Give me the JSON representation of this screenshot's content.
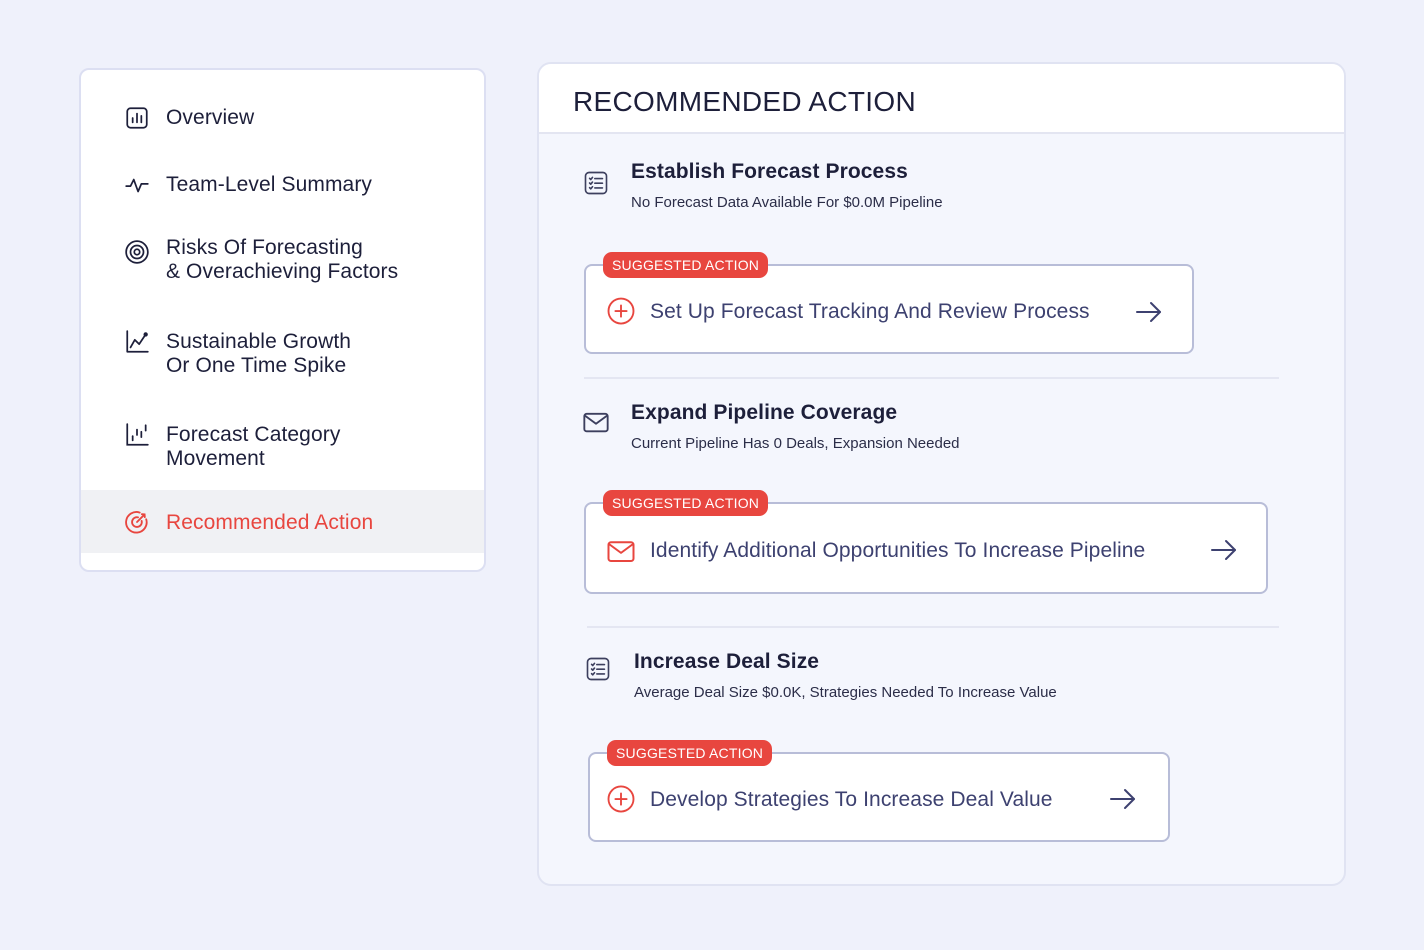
{
  "sidebar": {
    "items": [
      {
        "label": "Overview",
        "icon": "bar-chart-icon",
        "active": false
      },
      {
        "label": "Team-Level Summary",
        "icon": "pulse-icon",
        "active": false
      },
      {
        "label": "Risks Of Forecasting\n& Overachieving Factors",
        "icon": "target-icon",
        "active": false
      },
      {
        "label": "Sustainable Growth\nOr One Time Spike",
        "icon": "line-chart-icon",
        "active": false
      },
      {
        "label": "Forecast Category\nMovement",
        "icon": "column-chart-icon",
        "active": false
      },
      {
        "label": "Recommended Action",
        "icon": "target-arrow-icon",
        "active": true
      }
    ],
    "active_color": "#e8463f"
  },
  "panel": {
    "title": "RECOMMENDED ACTION",
    "recommendations": [
      {
        "title": "Establish Forecast Process",
        "subtitle": "No Forecast Data Available For $0.0M Pipeline",
        "icon": "checklist-icon",
        "badge": "SUGGESTED ACTION",
        "action": "Set Up Forecast Tracking And Review Process",
        "action_icon": "plus-circle-icon"
      },
      {
        "title": "Expand Pipeline Coverage",
        "subtitle": "Current Pipeline Has 0 Deals, Expansion Needed",
        "icon": "mail-icon",
        "badge": "SUGGESTED ACTION",
        "action": "Identify Additional Opportunities To Increase Pipeline",
        "action_icon": "mail-icon"
      },
      {
        "title": "Increase Deal Size",
        "subtitle": "Average Deal Size $0.0K, Strategies Needed To Increase Value",
        "icon": "checklist-icon",
        "badge": "SUGGESTED ACTION",
        "action": "Develop Strategies To Increase Deal Value",
        "action_icon": "plus-circle-icon"
      }
    ]
  },
  "colors": {
    "background": "#eff1fb",
    "accent": "#e8463f",
    "text": "#1d1f3a",
    "action_text": "#3d4170"
  }
}
